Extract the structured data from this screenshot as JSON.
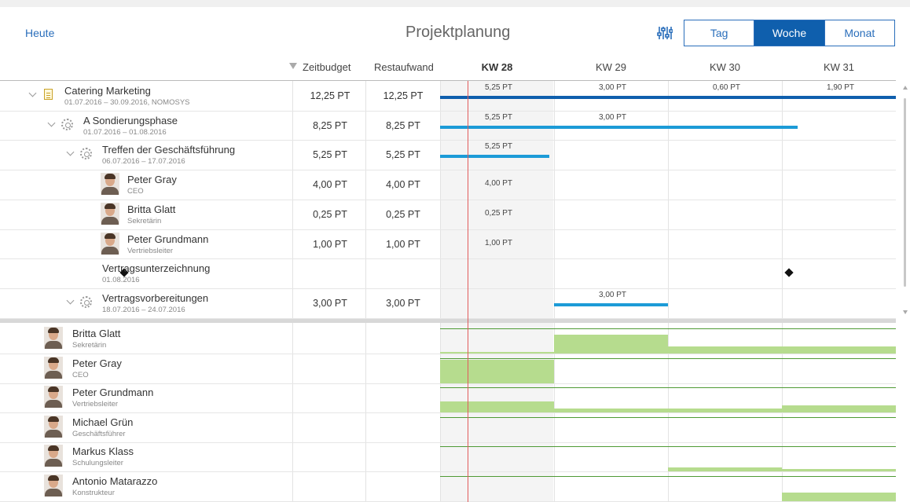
{
  "toolbar": {
    "today_label": "Heute",
    "title": "Projektplanung",
    "settings_icon": "sliders-icon",
    "views": [
      {
        "label": "Tag",
        "active": false
      },
      {
        "label": "Woche",
        "active": true
      },
      {
        "label": "Monat",
        "active": false
      }
    ]
  },
  "columns": {
    "budget": "Zeitbudget",
    "remaining": "Restaufwand",
    "weeks": [
      "KW 28",
      "KW 29",
      "KW 30",
      "KW 31"
    ],
    "current_week_index": 0
  },
  "colors": {
    "accent": "#2a6ebb",
    "active_segment": "#0f5fad",
    "project_bar": "#0f5fad",
    "task_bar": "#1c9bd7",
    "load_fill": "#b6dc8e",
    "load_line": "#4f9a35",
    "today_line": "#e25b5b"
  },
  "tasks": [
    {
      "name": "Catering Marketing",
      "sub": "01.07.2016 – 30.09.2016, NOMOSYS",
      "budget": "12,25 PT",
      "remaining": "12,25 PT",
      "icon": "document-icon",
      "week_values": [
        "5,25 PT",
        "3,00 PT",
        "0,60 PT",
        "1,90 PT"
      ]
    },
    {
      "name": "A Sondierungsphase",
      "sub": "01.07.2016 – 01.08.2016",
      "budget": "8,25 PT",
      "remaining": "8,25 PT",
      "icon": "gear-icon",
      "week_values": [
        "5,25 PT",
        "3,00 PT",
        "",
        ""
      ]
    },
    {
      "name": "Treffen der Geschäftsführung",
      "sub": "06.07.2016 – 17.07.2016",
      "budget": "5,25 PT",
      "remaining": "5,25 PT",
      "icon": "gear-icon",
      "week_values": [
        "5,25 PT",
        "",
        "",
        ""
      ]
    },
    {
      "name": "Peter Gray",
      "sub": "CEO",
      "budget": "4,00 PT",
      "remaining": "4,00 PT",
      "icon": "avatar",
      "week_values": [
        "4,00 PT",
        "",
        "",
        ""
      ]
    },
    {
      "name": "Britta Glatt",
      "sub": "Sekretärin",
      "budget": "0,25 PT",
      "remaining": "0,25 PT",
      "icon": "avatar",
      "week_values": [
        "0,25 PT",
        "",
        "",
        ""
      ]
    },
    {
      "name": "Peter Grundmann",
      "sub": "Vertriebsleiter",
      "budget": "1,00 PT",
      "remaining": "1,00 PT",
      "icon": "avatar",
      "week_values": [
        "1,00 PT",
        "",
        "",
        ""
      ]
    },
    {
      "name": "Vertragsunterzeichnung",
      "sub": "01.08.2016",
      "budget": "",
      "remaining": "",
      "icon": "milestone-icon",
      "week_values": [
        "",
        "",
        "",
        ""
      ]
    },
    {
      "name": "Vertragsvorbereitungen",
      "sub": "18.07.2016 – 24.07.2016",
      "budget": "3,00 PT",
      "remaining": "3,00 PT",
      "icon": "gear-icon",
      "week_values": [
        "",
        "3,00 PT",
        "",
        ""
      ]
    }
  ],
  "resources": [
    {
      "name": "Britta Glatt",
      "role": "Sekretärin",
      "load": [
        0.05,
        0.8,
        0.3,
        0.3
      ]
    },
    {
      "name": "Peter Gray",
      "role": "CEO",
      "load": [
        1.0,
        0.0,
        0.0,
        0.0
      ]
    },
    {
      "name": "Peter Grundmann",
      "role": "Vertriebsleiter",
      "load": [
        0.45,
        0.15,
        0.15,
        0.3
      ]
    },
    {
      "name": "Michael Grün",
      "role": "Geschäftsführer",
      "load": [
        0.0,
        0.0,
        0.0,
        0.0
      ]
    },
    {
      "name": "Markus Klass",
      "role": "Schulungsleiter",
      "load": [
        0.0,
        0.0,
        0.15,
        0.1
      ]
    },
    {
      "name": "Antonio Matarazzo",
      "role": "Konstrukteur",
      "load": [
        0.0,
        0.0,
        0.0,
        0.35
      ]
    }
  ]
}
